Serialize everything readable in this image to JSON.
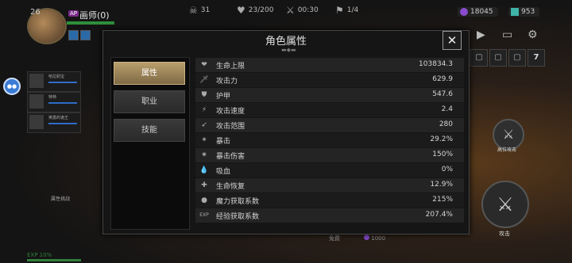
{
  "player": {
    "level": "26",
    "badge": "AP",
    "name": "画师(0)"
  },
  "top_stats": [
    {
      "icon": "skull-icon",
      "glyph": "☠",
      "value": "31"
    },
    {
      "icon": "heart-icon",
      "glyph": "♥",
      "value": "23/200"
    },
    {
      "icon": "crossed-swords-icon",
      "glyph": "⚔",
      "value": "00:30"
    },
    {
      "icon": "banner-icon",
      "glyph": "⚑",
      "value": "1/4"
    }
  ],
  "currencies": [
    {
      "icon": "purple-gem-icon",
      "color": "#8a4ccf",
      "value": "18045"
    },
    {
      "icon": "teal-gem-icon",
      "color": "#3fb4a8",
      "value": "953"
    }
  ],
  "party": [
    {
      "name": "哈拉耐宝"
    },
    {
      "name": "特特"
    },
    {
      "name": "英勇的诡王"
    }
  ],
  "left_labels": {
    "event": "属性挑战",
    "exp": "EXP 10%"
  },
  "modal": {
    "title": "角色属性",
    "tabs": [
      {
        "label": "属性",
        "active": true
      },
      {
        "label": "职业",
        "active": false
      },
      {
        "label": "技能",
        "active": false
      }
    ],
    "attributes": [
      {
        "icon": "heart-icon",
        "glyph": "❤",
        "name": "生命上限",
        "value": "103834.3"
      },
      {
        "icon": "sword-icon",
        "glyph": "🗡",
        "name": "攻击力",
        "value": "629.9"
      },
      {
        "icon": "shield-icon",
        "glyph": "⛊",
        "name": "护甲",
        "value": "547.6"
      },
      {
        "icon": "attack-speed-icon",
        "glyph": "⚡",
        "name": "攻击速度",
        "value": "2.4"
      },
      {
        "icon": "range-icon",
        "glyph": "➶",
        "name": "攻击范围",
        "value": "280"
      },
      {
        "icon": "critical-icon",
        "glyph": "✶",
        "name": "暴击",
        "value": "29.2%"
      },
      {
        "icon": "critical-damage-icon",
        "glyph": "✷",
        "name": "暴击伤害",
        "value": "150%"
      },
      {
        "icon": "lifesteal-icon",
        "glyph": "💧",
        "name": "吸血",
        "value": "0%"
      },
      {
        "icon": "regen-icon",
        "glyph": "✚",
        "name": "生命恢复",
        "value": "12.9%"
      },
      {
        "icon": "mana-icon",
        "glyph": "●",
        "name": "魔力获取系数",
        "value": "215%"
      },
      {
        "icon": "exp-icon",
        "glyph": "EXP",
        "name": "经验获取系数",
        "value": "207.4%"
      }
    ]
  },
  "bottom": {
    "free_label": "免费",
    "cost": "1000"
  },
  "skills": {
    "ultimate_label": "高位攻击",
    "attack_label": "攻击"
  },
  "right_top_icons": [
    "play-icon",
    "chat-icon",
    "settings-icon"
  ],
  "right_slots": [
    "lock-icon",
    "lock-icon",
    "lock-icon",
    "7"
  ]
}
